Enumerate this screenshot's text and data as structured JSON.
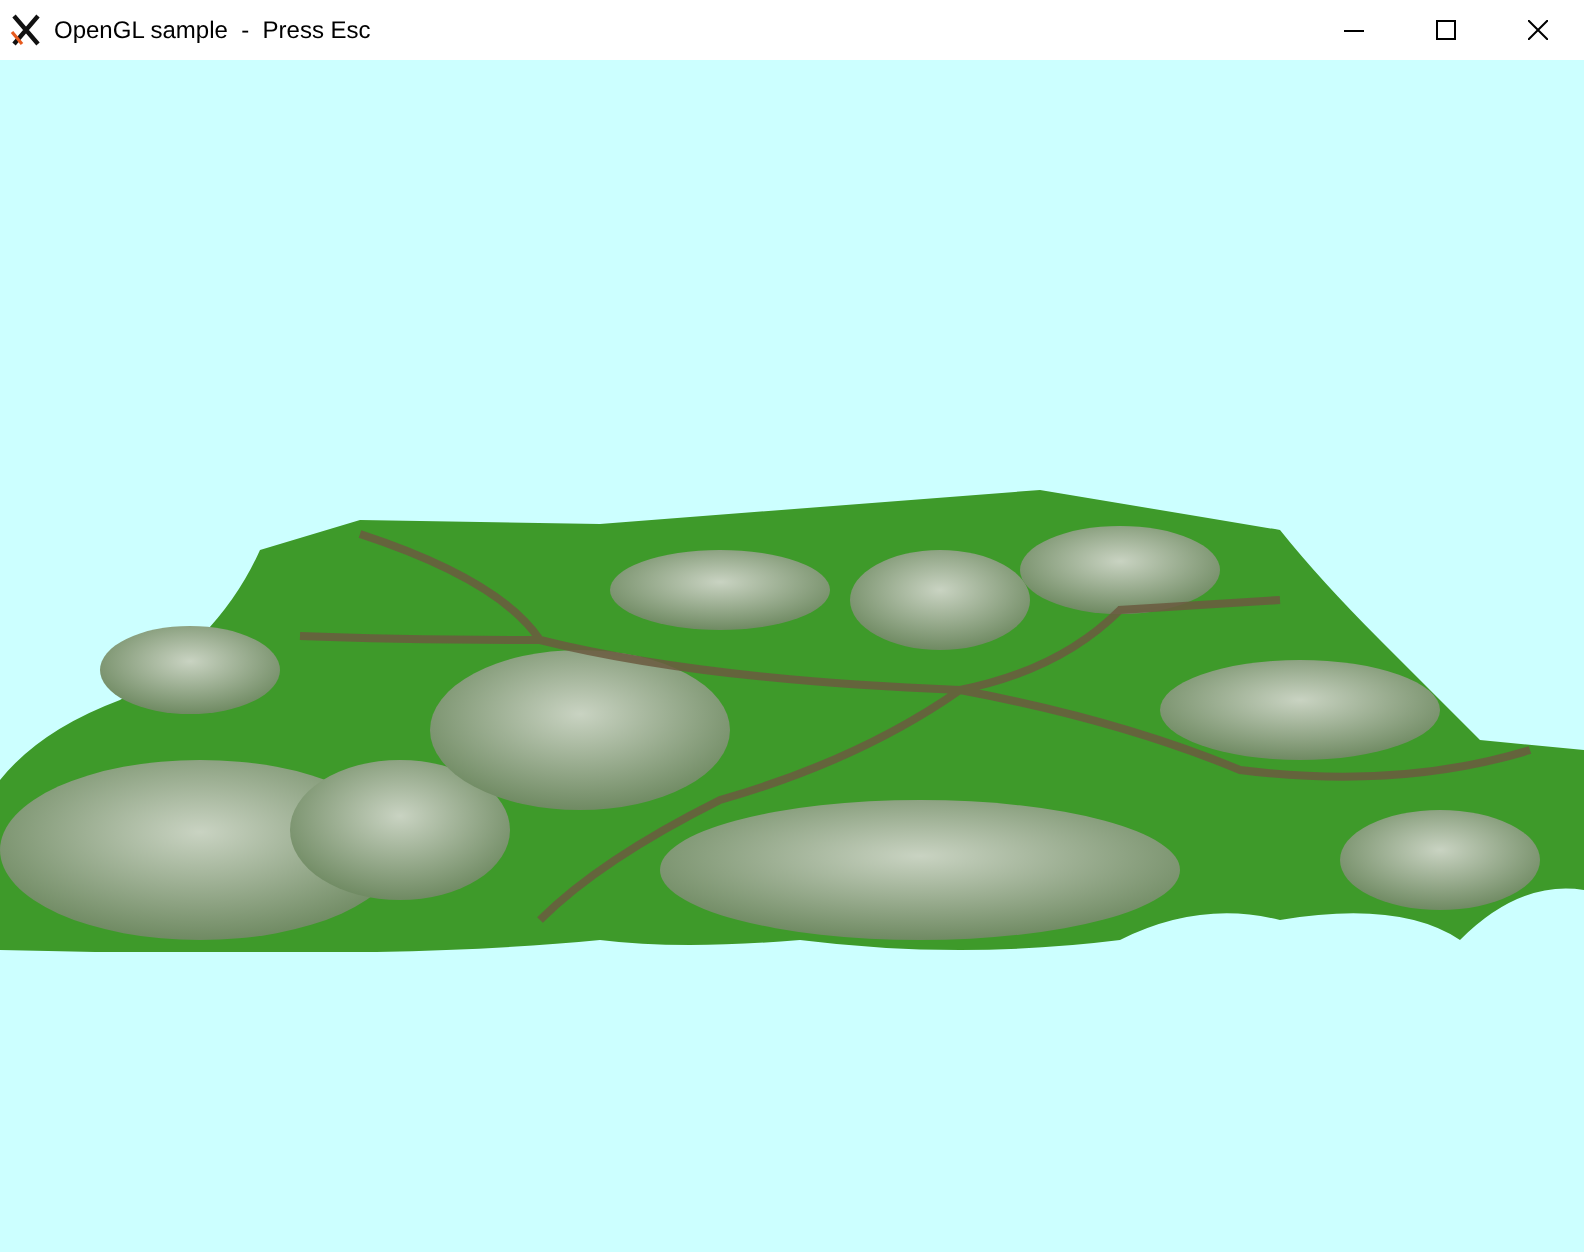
{
  "window": {
    "title": "OpenGL sample  -  Press Esc"
  }
}
